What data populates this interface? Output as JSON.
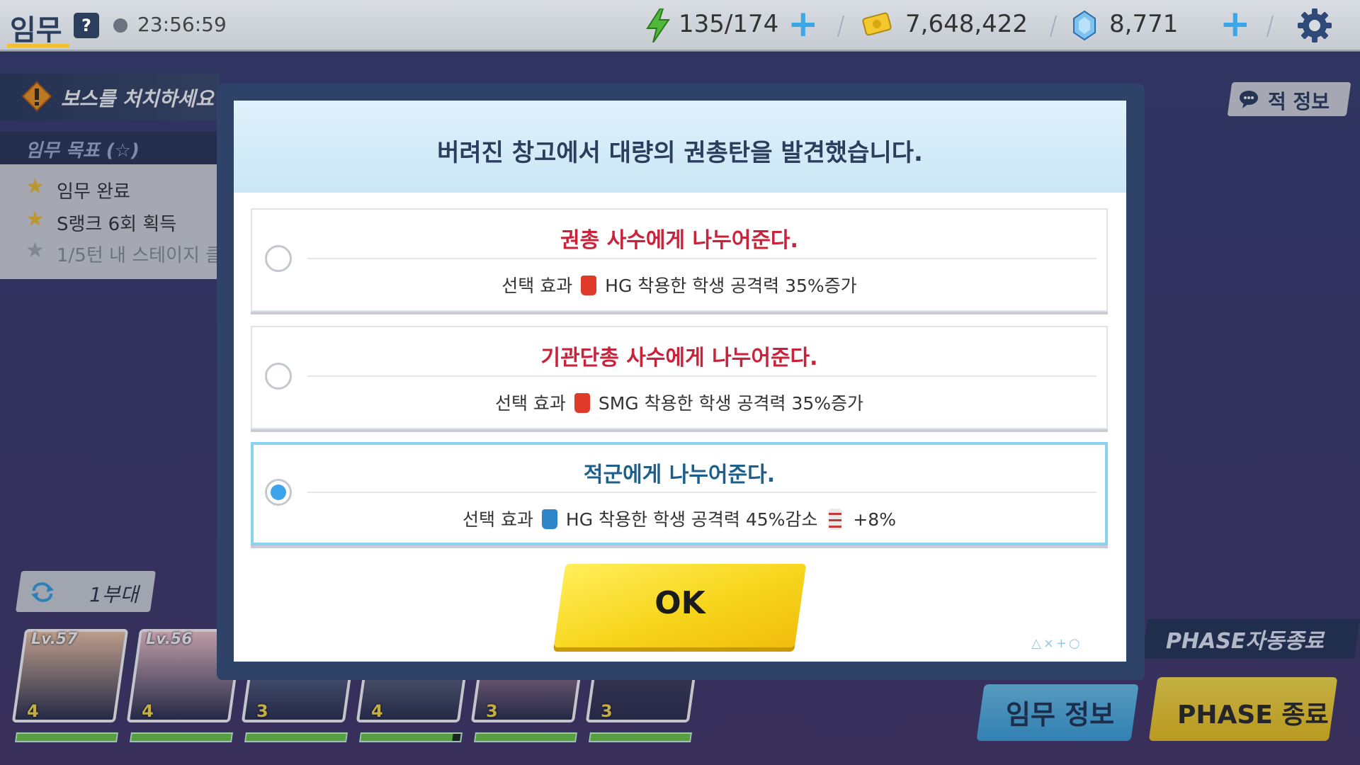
{
  "topbar": {
    "title": "임무",
    "help_label": "?",
    "timer": "23:56:59",
    "ap": "135/174",
    "credits": "7,648,422",
    "gems": "8,771"
  },
  "mission": {
    "banner": "보스를 처치하세요",
    "objectives_header": "임무 목표 (☆)",
    "objectives": [
      {
        "text": "임무 완료",
        "achieved": true
      },
      {
        "text": "S랭크 6회 획득",
        "achieved": true
      },
      {
        "text": "1/5턴 내 스테이지 클",
        "achieved": false
      }
    ],
    "enemy_info": "적 정보"
  },
  "squad": {
    "label": "1부대",
    "cards": [
      {
        "lv": "Lv.57",
        "rank": "4",
        "color": "#f3c9a8",
        "hp": 1.0
      },
      {
        "lv": "Lv.56",
        "rank": "4",
        "color": "#f6c8cf",
        "hp": 1.0
      },
      {
        "lv": "",
        "rank": "3",
        "color": "#7c8db1",
        "hp": 1.0
      },
      {
        "lv": "",
        "rank": "4",
        "color": "#8d95a8",
        "hp": 0.92
      },
      {
        "lv": "",
        "rank": "3",
        "color": "#e6a7b9",
        "hp": 1.0
      },
      {
        "lv": "",
        "rank": "3",
        "color": "#5b4a66",
        "hp": 1.0
      }
    ]
  },
  "bottom": {
    "auto_end": "PHASE자동종료",
    "mission_info": "임무 정보",
    "phase_end": "PHASE 종료"
  },
  "dialog": {
    "title": "버려진 창고에서 대량의 권총탄을 발견했습니다.",
    "options": [
      {
        "label": "권총 사수에게 나누어준다.",
        "effect_prefix": "선택 효과",
        "effect_text": "HG 착용한 학생 공격력 35%증가",
        "selected": false
      },
      {
        "label": "기관단총 사수에게 나누어준다.",
        "effect_prefix": "선택 효과",
        "effect_text": "SMG 착용한 학생 공격력 35%증가",
        "selected": false
      },
      {
        "label": "적군에게 나누어준다.",
        "effect_prefix": "선택 효과",
        "effect_text": "HG 착용한 학생 공격력 45%감소",
        "extra": "+8%",
        "selected": true
      }
    ],
    "ok": "OK",
    "decoration": "△×+○"
  }
}
